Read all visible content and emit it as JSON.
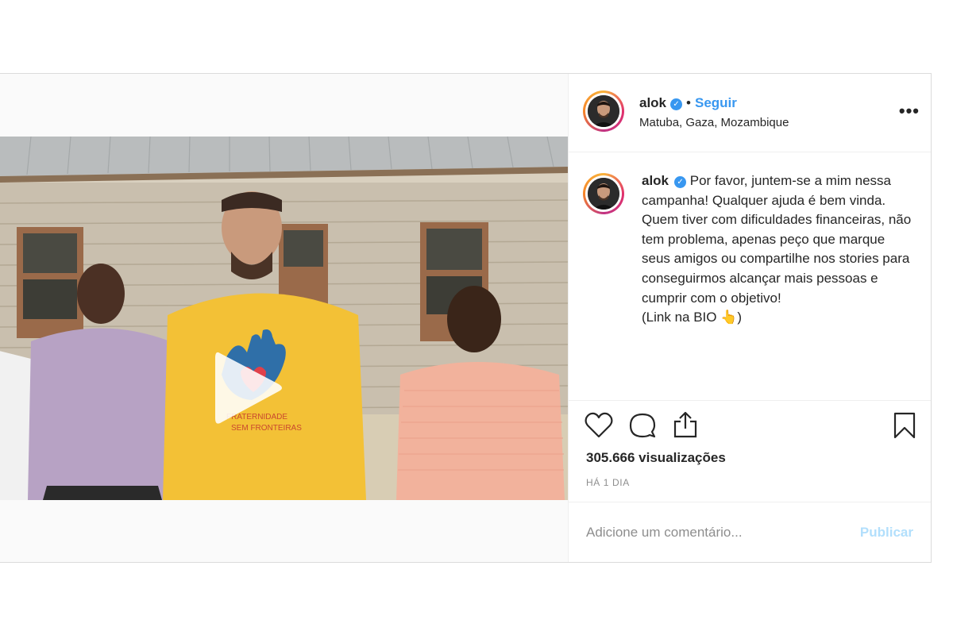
{
  "post": {
    "author": {
      "username": "alok",
      "verified_icon": "verified-badge-icon",
      "follow_label": "Seguir",
      "separator": "•",
      "location": "Matuba, Gaza, Mozambique"
    },
    "more_label": "•••",
    "caption": {
      "username": "alok",
      "text": "Por favor, juntem-se a mim nessa campanha! Qualquer ajuda é bem vinda.\nQuem tiver com dificuldades financeiras, não tem problema, apenas peço que marque seus amigos ou compartilhe nos stories para conseguirmos alcançar mais pessoas e cumprir com o objetivo!\n(Link na BIO 👆)"
    },
    "video": {
      "shirt_text_line1": "FRATERNIDADE",
      "shirt_text_line2": "SEM FRONTEIRAS"
    },
    "actions": {
      "like_icon": "heart-icon",
      "comment_icon": "comment-icon",
      "share_icon": "share-icon",
      "save_icon": "bookmark-icon"
    },
    "views_label": "305.666 visualizações",
    "time_ago": "HÁ 1 DIA",
    "comment": {
      "placeholder": "Adicione um comentário...",
      "publish_label": "Publicar"
    }
  },
  "colors": {
    "link_blue": "#3897f0",
    "publish_disabled": "#b2dffc",
    "border": "#dbdbdb",
    "shirt_yellow": "#f3c136"
  }
}
